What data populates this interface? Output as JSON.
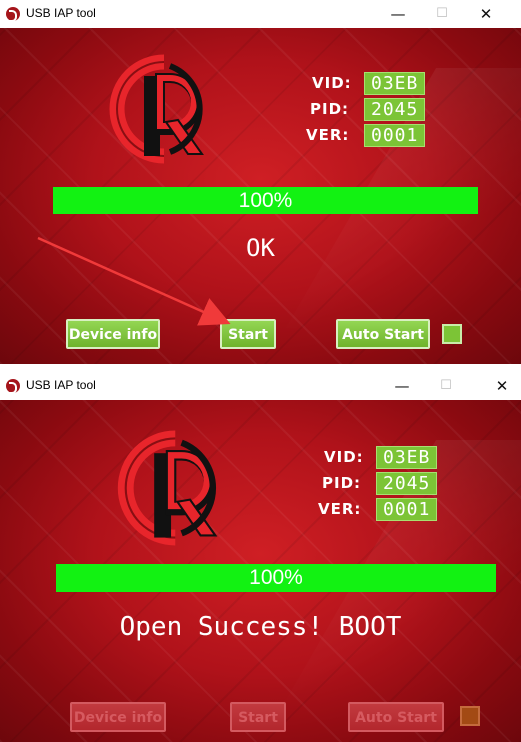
{
  "windows": [
    {
      "title": "USB IAP tool",
      "vid_label": "VID:",
      "vid": "03EB",
      "pid_label": "PID:",
      "pid": "2045",
      "ver_label": "VER:",
      "ver": "0001",
      "progress": 1.0,
      "progress_text": "100%",
      "status": "OK",
      "device_info": "Device info",
      "start": "Start",
      "auto_start": "Auto Start",
      "buttons_enabled": true
    },
    {
      "title": "USB IAP tool",
      "vid_label": "VID:",
      "vid": "03EB",
      "pid_label": "PID:",
      "pid": "2045",
      "ver_label": "VER:",
      "ver": "0001",
      "progress": 1.0,
      "progress_text": "100%",
      "status": "Open Success! BOOT",
      "device_info": "Device info",
      "start": "Start",
      "auto_start": "Auto Start",
      "buttons_enabled": false
    }
  ],
  "colors": {
    "progress_fill": "#12f212",
    "value_box": "#7cc436",
    "background_red": "#b0121a",
    "arrow": "#f03a3a"
  },
  "icons": {
    "app": "crd-logo-icon",
    "minimize": "minimize-icon",
    "maximize": "maximize-icon",
    "close": "close-icon",
    "annotation": "red-arrow-annotation"
  }
}
